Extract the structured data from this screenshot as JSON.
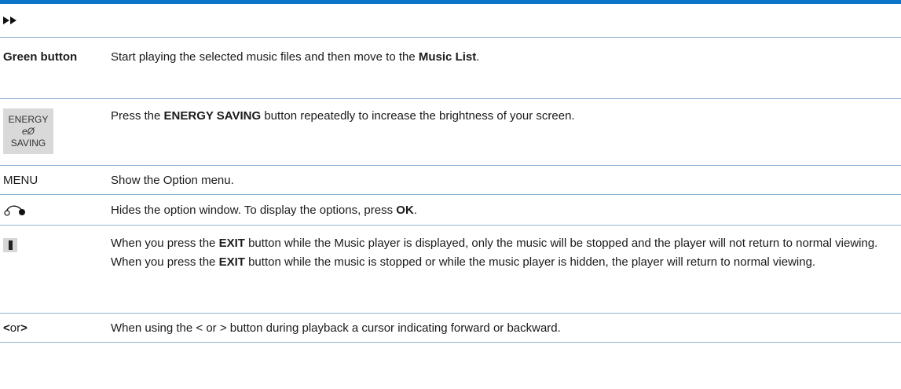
{
  "rows": [
    {
      "key_icon": "fast-forward-icon",
      "desc": ""
    },
    {
      "key": "Green button",
      "desc_parts": [
        "Start playing the selected music files and then move to the ",
        "Music List",
        "."
      ]
    },
    {
      "key_icon": "energy-saving-button-icon",
      "icon_label_top": "ENERGY",
      "icon_label_symbol": "eØ",
      "icon_label_bottom": "SAVING",
      "desc_parts": [
        "Press the ",
        "ENERGY SAVING",
        " button repeatedly to increase the brightness of your screen."
      ]
    },
    {
      "key": "MENU",
      "desc": "Show the Option menu."
    },
    {
      "key_icon": "back-return-icon",
      "desc_parts": [
        "Hides the option window. To display the options, press ",
        "OK",
        "."
      ]
    },
    {
      "key_icon": "exit-button-icon",
      "desc_parts": [
        "When you press the ",
        "EXIT",
        " button while the Music player is displayed, only the music will be stopped and the player will not return to normal viewing. When you press the ",
        "EXIT",
        " button while the music is stopped or while the music player is hidden, the player will return to normal viewing."
      ]
    },
    {
      "key_parts": [
        "<",
        " or ",
        ">"
      ],
      "desc": "When using the < or > button during playback a cursor indicating forward or backward."
    }
  ],
  "colors": {
    "accent": "#0a74c9",
    "divider": "#8fb3d6"
  }
}
